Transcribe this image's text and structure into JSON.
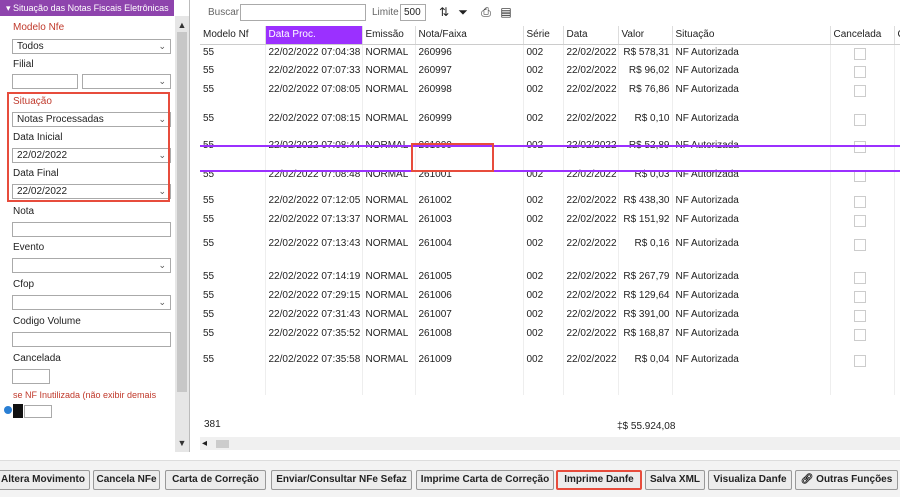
{
  "sidebar": {
    "title": "Situação das Notas Fiscais Eletrônicas",
    "modelo_label": "Modelo Nfe",
    "modelo_value": "Todos",
    "filial_label": "Filial",
    "situacao_label": "Situação",
    "situacao_value": "Notas Processadas",
    "data_inicial_label": "Data Inicial",
    "data_inicial_value": "22/02/2022",
    "data_final_label": "Data Final",
    "data_final_value": "22/02/2022",
    "nota_label": "Nota",
    "evento_label": "Evento",
    "cfop_label": "Cfop",
    "codigo_volume_label": "Codigo Volume",
    "cancelada_label": "Cancelada",
    "inutilizada_label": "se NF Inutilizada (não exibir demais"
  },
  "toolbar": {
    "buscar_label": "Buscar",
    "limite_label": "Limite",
    "limite_value": "500"
  },
  "grid": {
    "columns": [
      "Modelo Nf",
      "Data Proc.",
      "Emissão",
      "Nota/Faixa",
      "Série",
      "Data",
      "Valor",
      "Situação",
      "Cancelada",
      "C"
    ],
    "rows": [
      [
        "55",
        "22/02/2022 07:04:38",
        "NORMAL",
        "260996",
        "002",
        "22/02/2022",
        "R$ 578,31",
        "NF Autorizada"
      ],
      [
        "55",
        "22/02/2022 07:07:33",
        "NORMAL",
        "260997",
        "002",
        "22/02/2022",
        "R$ 96,02",
        "NF Autorizada"
      ],
      [
        "55",
        "22/02/2022 07:08:05",
        "NORMAL",
        "260998",
        "002",
        "22/02/2022",
        "R$ 76,86",
        "NF Autorizada"
      ],
      [
        "55",
        "22/02/2022 07:08:15",
        "NORMAL",
        "260999",
        "002",
        "22/02/2022",
        "R$ 0,10",
        "NF Autorizada"
      ],
      [
        "55",
        "22/02/2022 07:08:44",
        "NORMAL",
        "261000",
        "002",
        "22/02/2022",
        "R$ 52,89",
        "NF Autorizada"
      ],
      [
        "55",
        "22/02/2022 07:08:48",
        "NORMAL",
        "261001",
        "002",
        "22/02/2022",
        "R$ 0,03",
        "NF Autorizada"
      ],
      [
        "55",
        "22/02/2022 07:12:05",
        "NORMAL",
        "261002",
        "002",
        "22/02/2022",
        "R$ 438,30",
        "NF Autorizada"
      ],
      [
        "55",
        "22/02/2022 07:13:37",
        "NORMAL",
        "261003",
        "002",
        "22/02/2022",
        "R$ 151,92",
        "NF Autorizada"
      ],
      [
        "55",
        "22/02/2022 07:13:43",
        "NORMAL",
        "261004",
        "002",
        "22/02/2022",
        "R$ 0,16",
        "NF Autorizada"
      ],
      [
        "55",
        "22/02/2022 07:14:19",
        "NORMAL",
        "261005",
        "002",
        "22/02/2022",
        "R$ 267,79",
        "NF Autorizada"
      ],
      [
        "55",
        "22/02/2022 07:29:15",
        "NORMAL",
        "261006",
        "002",
        "22/02/2022",
        "R$ 129,64",
        "NF Autorizada"
      ],
      [
        "55",
        "22/02/2022 07:31:43",
        "NORMAL",
        "261007",
        "002",
        "22/02/2022",
        "R$ 391,00",
        "NF Autorizada"
      ],
      [
        "55",
        "22/02/2022 07:35:52",
        "NORMAL",
        "261008",
        "002",
        "22/02/2022",
        "R$ 168,87",
        "NF Autorizada"
      ],
      [
        "55",
        "22/02/2022 07:35:58",
        "NORMAL",
        "261009",
        "002",
        "22/02/2022",
        "R$ 0,04",
        "NF Autorizada"
      ]
    ],
    "count": "381",
    "total": "‡$ 55.924,08"
  },
  "buttons": [
    "Altera Movimento",
    "Cancela NFe",
    "Carta de Correção",
    "Enviar/Consultar NFe Sefaz",
    "Imprime Carta de Correção",
    "Imprime Danfe",
    "Salva XML",
    "Visualiza Danfe",
    "Outras Funções"
  ],
  "colors": {
    "accent": "#9b30ff",
    "sidebar_title": "#8e44ad",
    "highlight": "#e74c3c"
  }
}
